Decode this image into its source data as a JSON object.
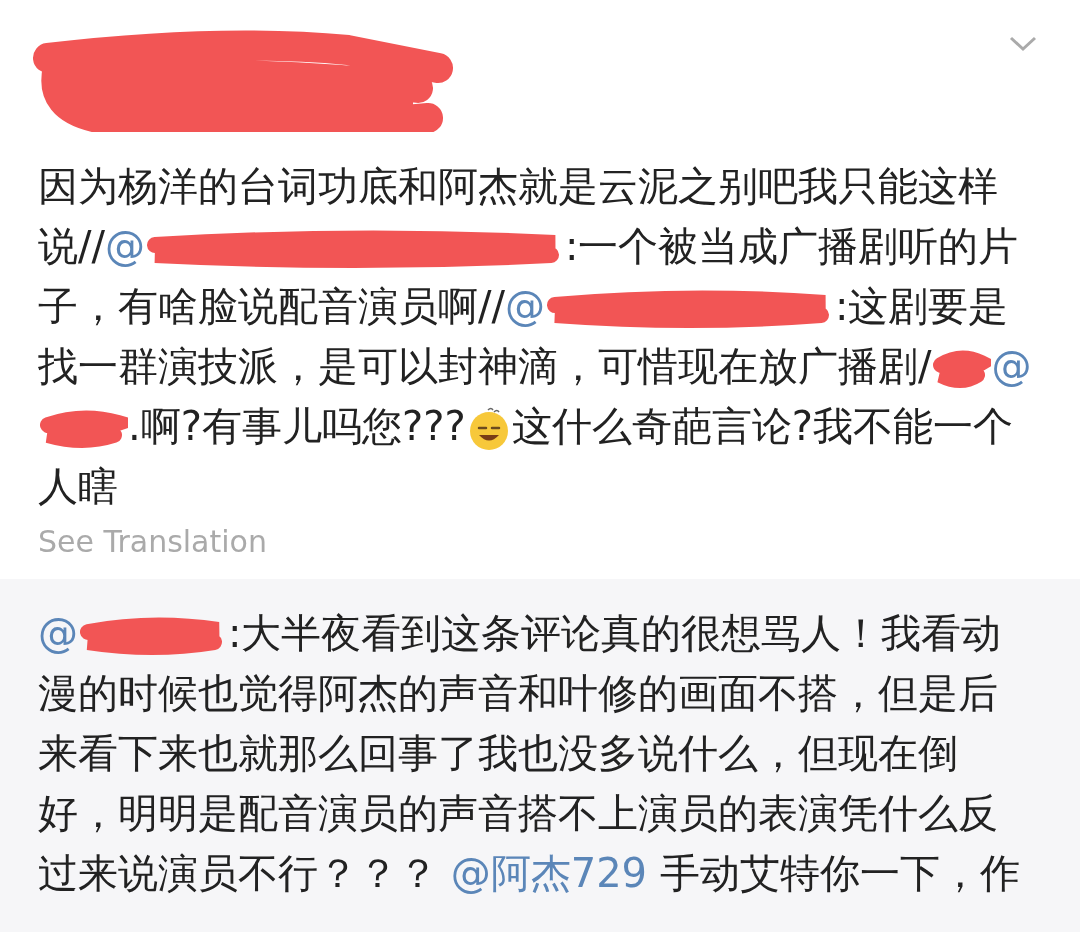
{
  "header": {
    "name_redacted": true
  },
  "post": {
    "segments": [
      {
        "kind": "text",
        "text": "因为杨洋的台词功底和阿杰就是云泥之别吧我只能这样说//"
      },
      {
        "kind": "mention",
        "text": "@"
      },
      {
        "kind": "redaction"
      },
      {
        "kind": "text",
        "text": ":一个被当成广播剧听的片子，有啥脸说配音演员啊//"
      },
      {
        "kind": "mention",
        "text": "@"
      },
      {
        "kind": "redaction"
      },
      {
        "kind": "text",
        "text": ":这剧要是找一群演技派，是可以封神滴，可惜现在放广播剧/"
      },
      {
        "kind": "redaction"
      },
      {
        "kind": "mention",
        "text": "@"
      },
      {
        "kind": "redaction"
      },
      {
        "kind": "text",
        "text": ".啊?有事儿吗您???"
      },
      {
        "kind": "emoji"
      },
      {
        "kind": "text",
        "text": "这什么奇葩言论?我不能一个人瞎"
      }
    ],
    "see_translation": "See Translation"
  },
  "reply": {
    "segments": [
      {
        "kind": "mention",
        "text": "@"
      },
      {
        "kind": "redaction"
      },
      {
        "kind": "text",
        "text": ":大半夜看到这条评论真的很想骂人！我看动漫的时候也觉得阿杰的声音和叶修的画面不搭，但是后来看下来也就那么回事了我也没多说什么，但现在倒好，明明是配音演员的声音搭不上演员的表演凭什么反过来说演员不行？？？ "
      },
      {
        "kind": "mention",
        "text": "@阿杰729"
      },
      {
        "kind": "text",
        "text": " 手动艾特你一下，作"
      }
    ]
  }
}
